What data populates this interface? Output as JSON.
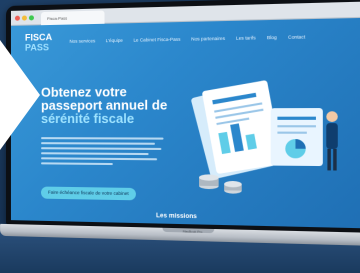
{
  "browser": {
    "tab_title": "Fisca-Pass",
    "colors": {
      "close": "#ec5f57",
      "minimize": "#f3bd39",
      "maximize": "#3fc950"
    }
  },
  "site": {
    "logo_line1": "FISCA",
    "logo_line2": "PASS",
    "nav": [
      "Nos services",
      "L'équipe",
      "Le Cabinet Fisca-Pass",
      "Nos partenaires",
      "Les tarifs",
      "Blog",
      "Contact"
    ],
    "hero_title_1": "Obtenez votre",
    "hero_title_2": "passeport annuel de",
    "hero_title_3": "sérénité fiscale",
    "cta": "Faire échéance fiscale de votre cabinet",
    "section_title": "Les missions"
  },
  "device": {
    "brand": "MacBook Pro"
  },
  "colors": {
    "screen_bg": "#2b87cc",
    "accent": "#5fcde8",
    "background": "#173457"
  }
}
